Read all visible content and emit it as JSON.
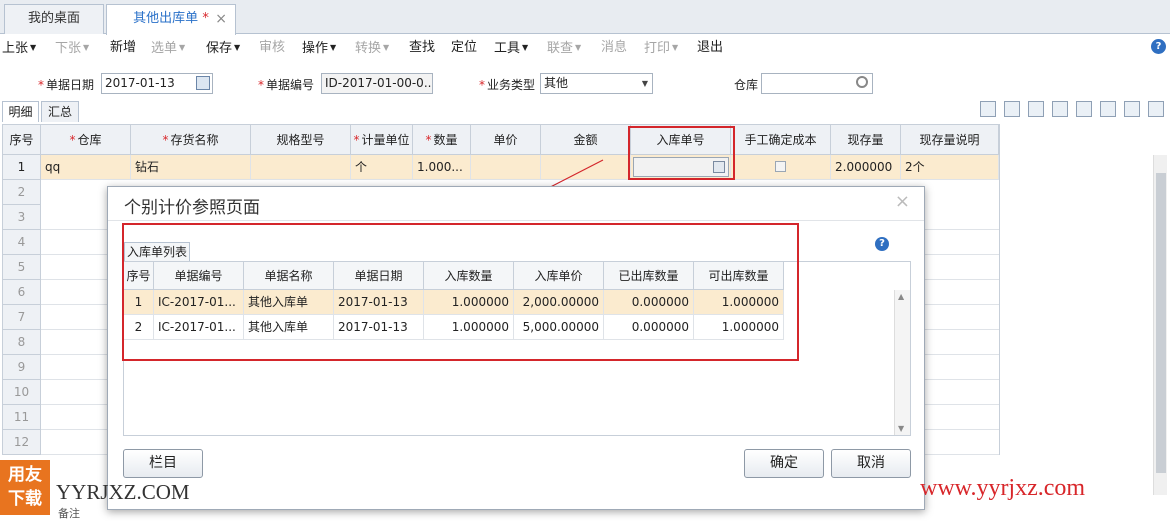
{
  "tabs": [
    {
      "label": "我的桌面"
    },
    {
      "label": "其他出库单"
    },
    {
      "modified_mark": "*"
    },
    {
      "close": "×"
    }
  ],
  "toolbar": {
    "items": [
      "上张",
      "下张",
      "新增",
      "选单",
      "保存",
      "审核",
      "操作",
      "转换",
      "查找",
      "定位",
      "工具",
      "联查",
      "消息",
      "打印",
      "退出"
    ],
    "help": "?"
  },
  "header": {
    "date_label": "单据日期",
    "date_value": "2017-01-13",
    "no_label": "单据编号",
    "no_value": "ID-2017-01-00-0...",
    "type_label": "业务类型",
    "type_value": "其他",
    "wh_label": "仓库",
    "wh_value": ""
  },
  "subtabs": [
    "明细",
    "汇总"
  ],
  "grid": {
    "columns": [
      "序号",
      "仓库",
      "存货名称",
      "规格型号",
      "计量单位",
      "数量",
      "单价",
      "金额",
      "入库单号",
      "手工确定成本",
      "现存量",
      "现存量说明"
    ],
    "row1": {
      "no": "1",
      "wh": "qq",
      "name": "钻石",
      "spec": "",
      "unit": "个",
      "qty": "1.000...",
      "price": "",
      "amount": "",
      "inbill": "",
      "manual": "",
      "stock": "2.000000",
      "stock_desc": "2个"
    },
    "row_numbers": [
      "2",
      "3",
      "4",
      "5",
      "6",
      "7",
      "8",
      "9",
      "10",
      "11",
      "12"
    ]
  },
  "dialog": {
    "title": "个别计价参照页面",
    "close": "×",
    "section_label": "入库单列表",
    "help": "?",
    "columns": [
      "序号",
      "单据编号",
      "单据名称",
      "单据日期",
      "入库数量",
      "入库单价",
      "已出库数量",
      "可出库数量"
    ],
    "rows": [
      {
        "no": "1",
        "bill_no": "IC-2017-01...",
        "bill_name": "其他入库单",
        "date": "2017-01-13",
        "in_qty": "1.000000",
        "in_price": "2,000.00000",
        "out_qty": "0.000000",
        "avail_qty": "1.000000"
      },
      {
        "no": "2",
        "bill_no": "IC-2017-01...",
        "bill_name": "其他入库单",
        "date": "2017-01-13",
        "in_qty": "1.000000",
        "in_price": "5,000.00000",
        "out_qty": "0.000000",
        "avail_qty": "1.000000"
      }
    ],
    "btn_columns": "栏目",
    "btn_ok": "确定",
    "btn_cancel": "取消"
  },
  "watermark": {
    "logo_top": "用友",
    "logo_bottom": "下载",
    "site": "YYRJXZ.COM",
    "url": "www.yyrjxz.com"
  },
  "footer": {
    "remark_label": "备注"
  },
  "colors": {
    "accent": "#2a71c9",
    "highlight_row": "#fbebcf",
    "red_box": "#d4262b"
  }
}
